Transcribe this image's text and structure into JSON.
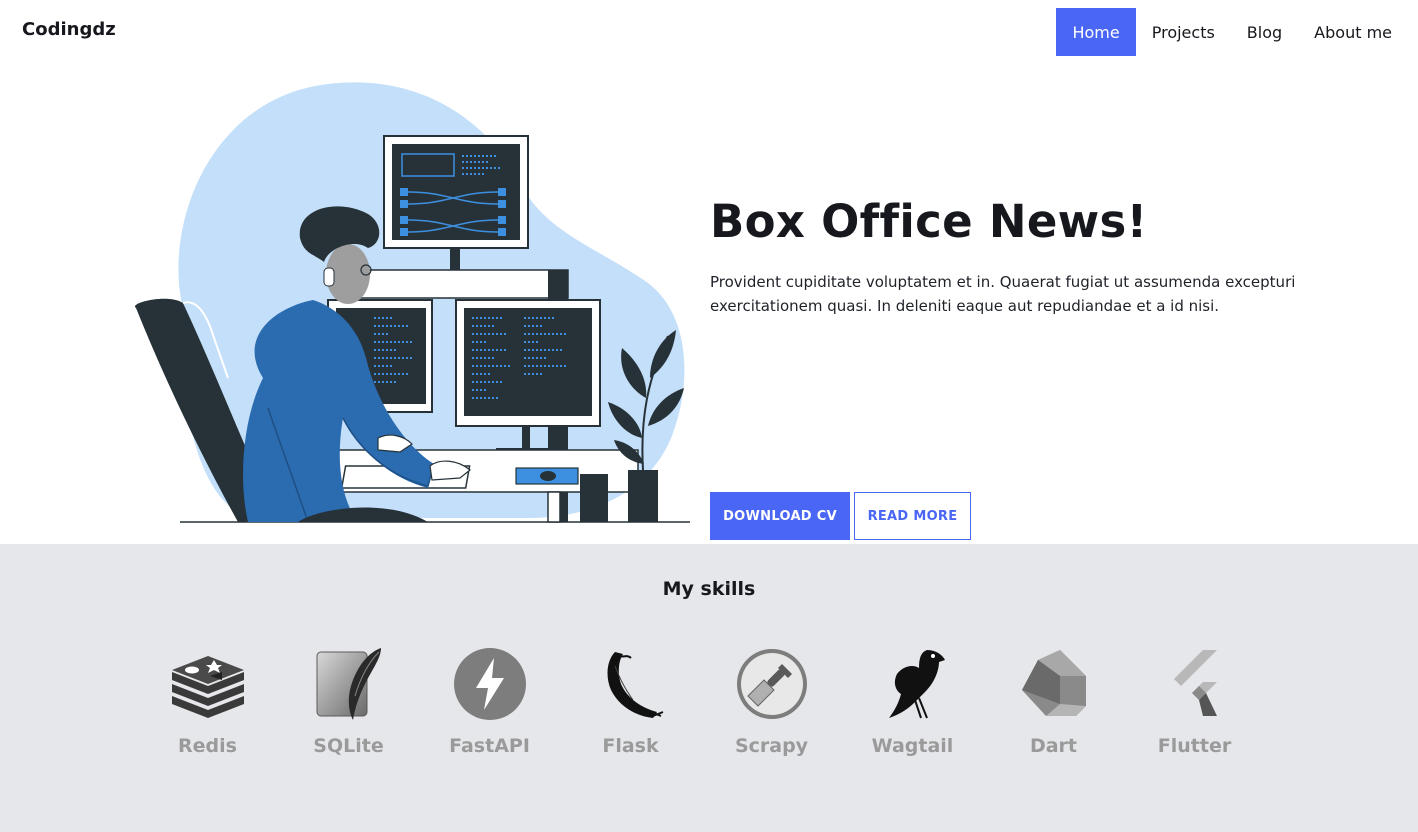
{
  "navbar": {
    "brand": "Codingdz",
    "items": [
      {
        "label": "Home",
        "active": true
      },
      {
        "label": "Projects",
        "active": false
      },
      {
        "label": "Blog",
        "active": false
      },
      {
        "label": "About me",
        "active": false
      }
    ]
  },
  "hero": {
    "illustration": "developer-at-desk-illustration",
    "title": "Box Office News!",
    "description": "Provident cupiditate voluptatem et in. Quaerat fugiat ut assumenda excepturi exercitationem quasi. In deleniti eaque aut repudiandae et a id nisi.",
    "primary_button": "DOWNLOAD CV",
    "secondary_button": "READ MORE"
  },
  "skills": {
    "title": "My skills",
    "items": [
      {
        "label": "Redis",
        "icon": "redis-icon"
      },
      {
        "label": "SQLite",
        "icon": "sqlite-icon"
      },
      {
        "label": "FastAPI",
        "icon": "fastapi-icon"
      },
      {
        "label": "Flask",
        "icon": "flask-icon"
      },
      {
        "label": "Scrapy",
        "icon": "scrapy-icon"
      },
      {
        "label": "Wagtail",
        "icon": "wagtail-icon"
      },
      {
        "label": "Dart",
        "icon": "dart-icon"
      },
      {
        "label": "Flutter",
        "icon": "flutter-icon"
      }
    ]
  },
  "colors": {
    "accent": "#4a66f5",
    "skills_background": "#e6e7eb",
    "illustration_blob": "#c4dff9",
    "shirt": "#2b6cb0",
    "dark": "#263238"
  }
}
